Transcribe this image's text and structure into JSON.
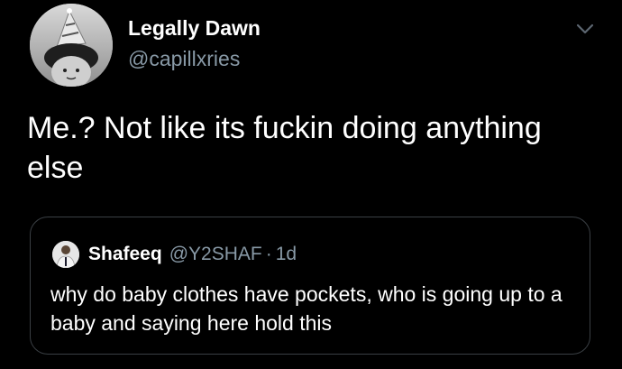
{
  "tweet": {
    "author": {
      "display_name": "Legally Dawn",
      "handle": "@capillxries"
    },
    "menu_icon": "chevron-down-icon",
    "text": "Me.? Not like its fuckin doing anything else"
  },
  "quote": {
    "author": {
      "display_name": "Shafeeq",
      "handle": "@Y2SHAF"
    },
    "separator": "·",
    "time": "1d",
    "text": "why do baby clothes have pockets, who is going up to a baby and saying here hold this"
  },
  "colors": {
    "background": "#000000",
    "primary_text": "#ffffff",
    "secondary_text": "#8899a6",
    "card_border": "#3a3f44"
  }
}
